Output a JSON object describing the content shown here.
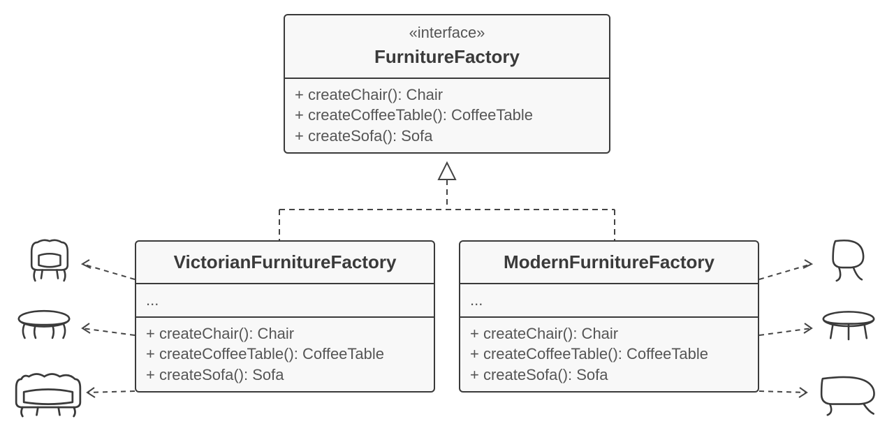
{
  "interface": {
    "stereotype": "«interface»",
    "name": "FurnitureFactory",
    "ops": [
      "+ createChair(): Chair",
      "+ createCoffeeTable(): CoffeeTable",
      "+ createSofa(): Sofa"
    ]
  },
  "victorian": {
    "name": "VictorianFurnitureFactory",
    "attrs": "...",
    "ops": [
      "+ createChair(): Chair",
      "+ createCoffeeTable(): CoffeeTable",
      "+ createSofa(): Sofa"
    ]
  },
  "modern": {
    "name": "ModernFurnitureFactory",
    "attrs": "...",
    "ops": [
      "+ createChair(): Chair",
      "+ createCoffeeTable(): CoffeeTable",
      "+ createSofa(): Sofa"
    ]
  },
  "icons": {
    "victorian": [
      "chair-victorian",
      "table-victorian",
      "sofa-victorian"
    ],
    "modern": [
      "chair-modern",
      "table-modern",
      "sofa-modern"
    ]
  }
}
